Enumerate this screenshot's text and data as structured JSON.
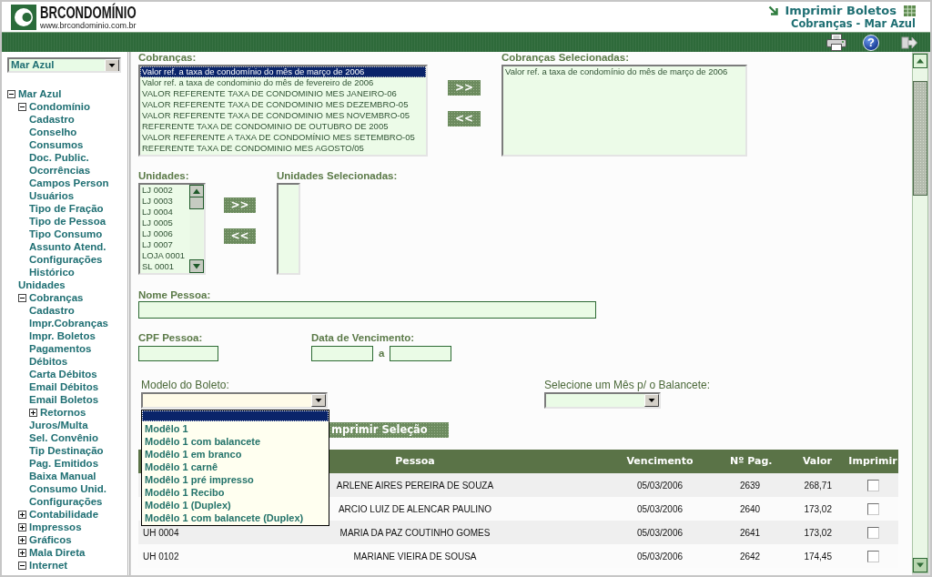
{
  "header": {
    "logo_text": "BRCONDOMÍNIO",
    "logo_url": "www.brcondominio.com.br",
    "title": "Imprimir Boletos",
    "subtitle": "Cobranças - Mar Azul"
  },
  "toolbar": {
    "help": "?"
  },
  "sidebar": {
    "condo_select": {
      "value": "Mar Azul"
    },
    "tree": [
      {
        "label": "Mar Azul",
        "kind": "folder",
        "expanded": true,
        "children": [
          {
            "label": "Condomínio",
            "kind": "folder",
            "expanded": true,
            "children": [
              {
                "label": "Cadastro",
                "kind": "page"
              },
              {
                "label": "Conselho",
                "kind": "page"
              },
              {
                "label": "Consumos",
                "kind": "page"
              },
              {
                "label": "Doc. Public.",
                "kind": "page"
              },
              {
                "label": "Ocorrências",
                "kind": "page"
              },
              {
                "label": "Campos Person",
                "kind": "page"
              },
              {
                "label": "Usuários",
                "kind": "page"
              },
              {
                "label": "Tipo de Fração",
                "kind": "page"
              },
              {
                "label": "Tipo de Pessoa",
                "kind": "page"
              },
              {
                "label": "Tipo Consumo",
                "kind": "page"
              },
              {
                "label": "Assunto Atend.",
                "kind": "page"
              },
              {
                "label": "Configurações",
                "kind": "page"
              },
              {
                "label": "Histórico",
                "kind": "page"
              }
            ]
          },
          {
            "label": "Unidades",
            "kind": "page"
          },
          {
            "label": "Cobranças",
            "kind": "folder",
            "expanded": true,
            "children": [
              {
                "label": "Cadastro",
                "kind": "page"
              },
              {
                "label": "Impr.Cobranças",
                "kind": "page"
              },
              {
                "label": "Impr. Boletos",
                "kind": "page"
              },
              {
                "label": "Pagamentos",
                "kind": "page"
              },
              {
                "label": "Débitos",
                "kind": "page"
              },
              {
                "label": "Carta Débitos",
                "kind": "page"
              },
              {
                "label": "Email Débitos",
                "kind": "page"
              },
              {
                "label": "Email Boletos",
                "kind": "page"
              },
              {
                "label": "Retornos",
                "kind": "folder",
                "expanded": false
              },
              {
                "label": "Juros/Multa",
                "kind": "page"
              },
              {
                "label": "Sel. Convênio",
                "kind": "page"
              },
              {
                "label": "Tip Destinação",
                "kind": "page"
              },
              {
                "label": "Pag. Emitidos",
                "kind": "page"
              },
              {
                "label": "Baixa Manual",
                "kind": "page"
              },
              {
                "label": "Consumo Unid.",
                "kind": "page"
              },
              {
                "label": "Configurações",
                "kind": "page"
              }
            ]
          },
          {
            "label": "Contabilidade",
            "kind": "folder",
            "expanded": false
          },
          {
            "label": "Impressos",
            "kind": "folder",
            "expanded": false
          },
          {
            "label": "Gráficos",
            "kind": "folder",
            "expanded": false
          },
          {
            "label": "Mala Direta",
            "kind": "folder",
            "expanded": false
          },
          {
            "label": "Internet",
            "kind": "folder",
            "expanded": true
          }
        ]
      }
    ]
  },
  "form": {
    "cobrancas": {
      "label": "Cobranças:",
      "options": [
        {
          "text": "Valor ref. a taxa de condomínio do mês de março de 2006",
          "selected": true
        },
        {
          "text": "Valor ref. a taxa de condominio do mês de fevereiro de 2006",
          "selected": false
        },
        {
          "text": "VALOR REFERENTE TAXA DE CONDOMINIO MES JANEIRO-06",
          "selected": false
        },
        {
          "text": "VALOR REFERENTE TAXA DE CONDOMINIO MES DEZEMBRO-05",
          "selected": false
        },
        {
          "text": "VALOR REFERENTE TAXA DE CONDOMINIO MES NOVEMBRO-05",
          "selected": false
        },
        {
          "text": "REFERENTE TAXA DE CONDOMINIO DE OUTUBRO DE 2005",
          "selected": false
        },
        {
          "text": "VALOR REFERENTE A TAXA DE CONDOMÍNIO MES SETEMBRO-05",
          "selected": false
        },
        {
          "text": "REFERENTE TAXA DE CONDOMINIO MES AGOSTO/05",
          "selected": false
        }
      ],
      "add_button": ">>",
      "remove_button": "<<"
    },
    "cobrancas_selecionadas": {
      "label": "Cobranças Selecionadas:",
      "options": [
        {
          "text": "Valor ref. a taxa de condomínio do mês de março de 2006",
          "selected": false
        }
      ]
    },
    "unidades": {
      "label": "Unidades:",
      "options": [
        {
          "text": "LJ 0002",
          "selected": false
        },
        {
          "text": "LJ 0003",
          "selected": false
        },
        {
          "text": "LJ 0004",
          "selected": false
        },
        {
          "text": "LJ 0005",
          "selected": false
        },
        {
          "text": "LJ 0006",
          "selected": false
        },
        {
          "text": "LJ 0007",
          "selected": false
        },
        {
          "text": "LOJA 0001",
          "selected": false
        },
        {
          "text": "SL 0001",
          "selected": false
        }
      ],
      "add_button": ">>",
      "remove_button": "<<"
    },
    "unidades_selecionadas": {
      "label": "Unidades Selecionadas:"
    },
    "nome_pessoa": {
      "label": "Nome Pessoa:"
    },
    "cpf_pessoa": {
      "label": "CPF Pessoa:"
    },
    "data_vencimento": {
      "label": "Data de Vencimento:",
      "separator": "a"
    },
    "modelo_boleto": {
      "label": "Modelo do Boleto:",
      "expanded": true,
      "options": [
        {
          "selected": true
        },
        {
          "text": "Modêlo 1",
          "selected": false
        },
        {
          "text": "Modêlo 1 com balancete",
          "selected": false
        },
        {
          "text": "Modêlo 1 em branco",
          "selected": false
        },
        {
          "text": "Modêlo 1 carnê",
          "selected": false
        },
        {
          "text": "Modêlo 1 pré impresso",
          "selected": false
        },
        {
          "text": "Modêlo 1 Recibo",
          "selected": false
        },
        {
          "text": "Modêlo 1 (Duplex)",
          "selected": false
        },
        {
          "text": "Modêlo 1 com balancete (Duplex)",
          "selected": false
        }
      ]
    },
    "mes_balancete": {
      "label": "Selecione um Mês p/ o Balancete:"
    },
    "print_button": "mprimir Seleção"
  },
  "table": {
    "columns": [
      "Pessoa",
      "Vencimento",
      "Nº Pag.",
      "Valor",
      "Imprimir"
    ],
    "rows": [
      {
        "pessoa": "ARLENE AIRES PEREIRA DE SOUZA",
        "vencimento": "05/03/2006",
        "n_pag": "2639",
        "valor": "268,71",
        "checked": false
      },
      {
        "pessoa": "ARCIO LUIZ DE ALENCAR PAULINO",
        "vencimento": "05/03/2006",
        "n_pag": "2640",
        "valor": "173,02",
        "checked": false
      },
      {
        "column_1": "UH 0004",
        "pessoa": "MARIA DA PAZ COUTINHO GOMES",
        "vencimento": "05/03/2006",
        "n_pag": "2641",
        "valor": "173,02",
        "checked": false
      },
      {
        "column_1": "UH 0102",
        "pessoa": "MARIANE VIEIRA DE SOUSA",
        "vencimento": "05/03/2006",
        "n_pag": "2642",
        "valor": "174,45",
        "checked": false
      }
    ]
  }
}
